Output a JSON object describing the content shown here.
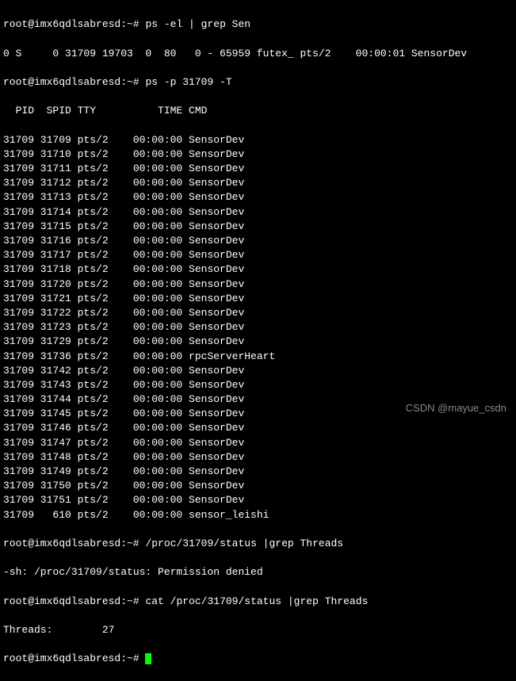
{
  "prompt": "root@imx6qdlsabresd:~#",
  "commands": {
    "cmd1": "ps -el | grep Sen",
    "cmd1_output": "0 S     0 31709 19703  0  80   0 - 65959 futex_ pts/2    00:00:01 SensorDev",
    "cmd2": "ps -p 31709 -T",
    "cmd3": "/proc/31709/status |grep Threads",
    "cmd3_output": "-sh: /proc/31709/status: Permission denied",
    "cmd4": "cat /proc/31709/status |grep Threads",
    "cmd4_output": "Threads:        27"
  },
  "ps_header": "  PID  SPID TTY          TIME CMD",
  "ps_rows": [
    {
      "pid": "31709",
      "spid": "31709",
      "tty": "pts/2",
      "time": "00:00:00",
      "cmd": "SensorDev"
    },
    {
      "pid": "31709",
      "spid": "31710",
      "tty": "pts/2",
      "time": "00:00:00",
      "cmd": "SensorDev"
    },
    {
      "pid": "31709",
      "spid": "31711",
      "tty": "pts/2",
      "time": "00:00:00",
      "cmd": "SensorDev"
    },
    {
      "pid": "31709",
      "spid": "31712",
      "tty": "pts/2",
      "time": "00:00:00",
      "cmd": "SensorDev"
    },
    {
      "pid": "31709",
      "spid": "31713",
      "tty": "pts/2",
      "time": "00:00:00",
      "cmd": "SensorDev"
    },
    {
      "pid": "31709",
      "spid": "31714",
      "tty": "pts/2",
      "time": "00:00:00",
      "cmd": "SensorDev"
    },
    {
      "pid": "31709",
      "spid": "31715",
      "tty": "pts/2",
      "time": "00:00:00",
      "cmd": "SensorDev"
    },
    {
      "pid": "31709",
      "spid": "31716",
      "tty": "pts/2",
      "time": "00:00:00",
      "cmd": "SensorDev"
    },
    {
      "pid": "31709",
      "spid": "31717",
      "tty": "pts/2",
      "time": "00:00:00",
      "cmd": "SensorDev"
    },
    {
      "pid": "31709",
      "spid": "31718",
      "tty": "pts/2",
      "time": "00:00:00",
      "cmd": "SensorDev"
    },
    {
      "pid": "31709",
      "spid": "31720",
      "tty": "pts/2",
      "time": "00:00:00",
      "cmd": "SensorDev"
    },
    {
      "pid": "31709",
      "spid": "31721",
      "tty": "pts/2",
      "time": "00:00:00",
      "cmd": "SensorDev"
    },
    {
      "pid": "31709",
      "spid": "31722",
      "tty": "pts/2",
      "time": "00:00:00",
      "cmd": "SensorDev"
    },
    {
      "pid": "31709",
      "spid": "31723",
      "tty": "pts/2",
      "time": "00:00:00",
      "cmd": "SensorDev"
    },
    {
      "pid": "31709",
      "spid": "31729",
      "tty": "pts/2",
      "time": "00:00:00",
      "cmd": "SensorDev"
    },
    {
      "pid": "31709",
      "spid": "31736",
      "tty": "pts/2",
      "time": "00:00:00",
      "cmd": "rpcServerHeart"
    },
    {
      "pid": "31709",
      "spid": "31742",
      "tty": "pts/2",
      "time": "00:00:00",
      "cmd": "SensorDev"
    },
    {
      "pid": "31709",
      "spid": "31743",
      "tty": "pts/2",
      "time": "00:00:00",
      "cmd": "SensorDev"
    },
    {
      "pid": "31709",
      "spid": "31744",
      "tty": "pts/2",
      "time": "00:00:00",
      "cmd": "SensorDev"
    },
    {
      "pid": "31709",
      "spid": "31745",
      "tty": "pts/2",
      "time": "00:00:00",
      "cmd": "SensorDev"
    },
    {
      "pid": "31709",
      "spid": "31746",
      "tty": "pts/2",
      "time": "00:00:00",
      "cmd": "SensorDev"
    },
    {
      "pid": "31709",
      "spid": "31747",
      "tty": "pts/2",
      "time": "00:00:00",
      "cmd": "SensorDev"
    },
    {
      "pid": "31709",
      "spid": "31748",
      "tty": "pts/2",
      "time": "00:00:00",
      "cmd": "SensorDev"
    },
    {
      "pid": "31709",
      "spid": "31749",
      "tty": "pts/2",
      "time": "00:00:00",
      "cmd": "SensorDev"
    },
    {
      "pid": "31709",
      "spid": "31750",
      "tty": "pts/2",
      "time": "00:00:00",
      "cmd": "SensorDev"
    },
    {
      "pid": "31709",
      "spid": "31751",
      "tty": "pts/2",
      "time": "00:00:00",
      "cmd": "SensorDev"
    },
    {
      "pid": "31709",
      "spid": "610",
      "tty": "pts/2",
      "time": "00:00:00",
      "cmd": "sensor_leishi"
    }
  ],
  "watermark": "CSDN @mayue_csdn"
}
